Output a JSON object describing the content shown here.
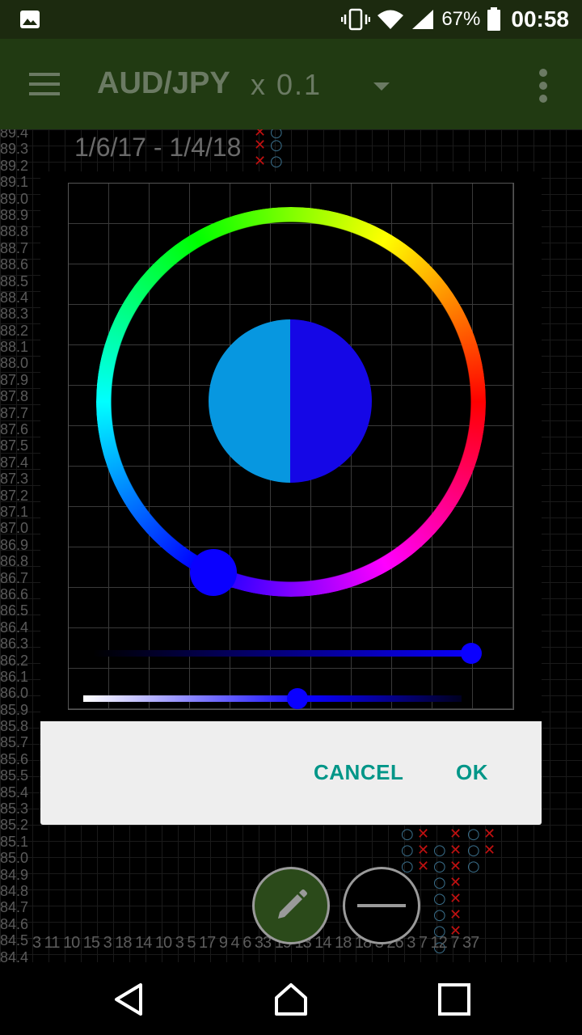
{
  "status_bar": {
    "battery": "67%",
    "time": "00:58",
    "icons": [
      "gallery-icon",
      "vibrate-icon",
      "wifi-icon",
      "signal-icon",
      "battery-icon"
    ]
  },
  "app_bar": {
    "title": "AUD/JPY",
    "multiplier": "x 0.1",
    "icons": [
      "menu-icon",
      "dropdown-icon",
      "overflow-icon"
    ]
  },
  "chart": {
    "date_range": "1/6/17 - 1/4/18",
    "y_ticks": [
      "89.4",
      "89.3",
      "89.2",
      "89.1",
      "89.0",
      "88.9",
      "88.8",
      "88.7",
      "88.6",
      "88.5",
      "88.4",
      "88.3",
      "88.2",
      "88.1",
      "88.0",
      "87.9",
      "87.8",
      "87.7",
      "87.6",
      "87.5",
      "87.4",
      "87.3",
      "87.2",
      "87.1",
      "87.0",
      "86.9",
      "86.8",
      "86.7",
      "86.6",
      "86.5",
      "86.4",
      "86.3",
      "86.2",
      "86.1",
      "86.0",
      "85.9",
      "85.8",
      "85.7",
      "85.6",
      "85.5",
      "85.4",
      "85.3",
      "85.2",
      "85.1",
      "85.0",
      "84.9",
      "84.8",
      "84.7",
      "84.6",
      "84.5",
      "84.4"
    ],
    "column_counts": "3 11 10 15 3 18 14 10 3 5 17 9 4 6 33 19 13 14 18 18 3 26 3 7 12 7 37",
    "colors": {
      "x_mark": "#c01010",
      "o_mark": "#3a6e8a",
      "grid": "#1a1a1a"
    }
  },
  "color_picker_dialog": {
    "old_color": "#0797e0",
    "new_color": "#1507e6",
    "hue_color": "#0a00ff",
    "saturation": 1.0,
    "value": 0.55,
    "cancel_label": "CANCEL",
    "ok_label": "OK",
    "accent_color": "#009688"
  },
  "fab": {
    "edit_icon": "pencil-icon",
    "line_icon": "horizontal-line-icon"
  },
  "nav_bar": {
    "icons": [
      "back-icon",
      "home-icon",
      "recents-icon"
    ]
  }
}
